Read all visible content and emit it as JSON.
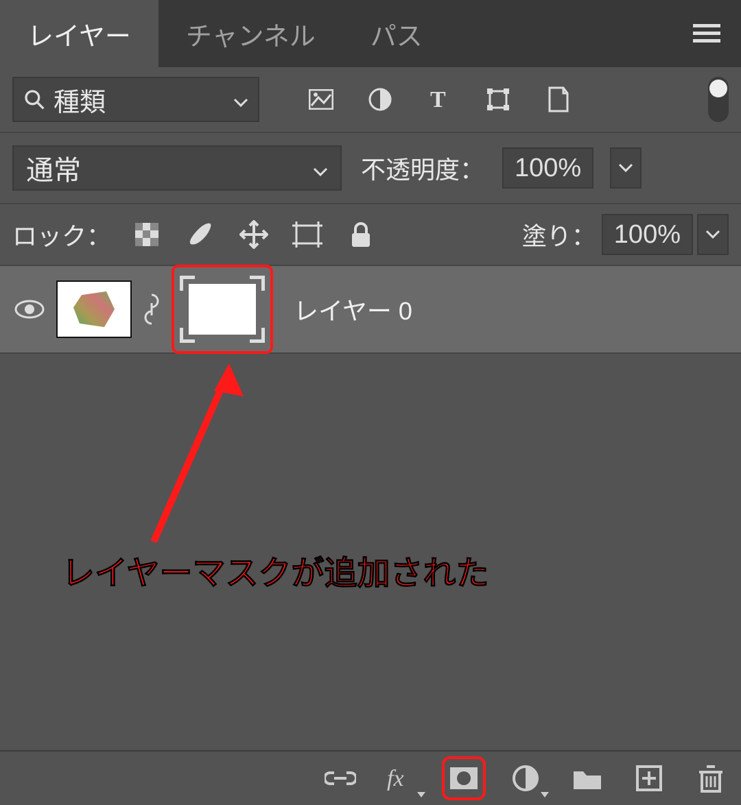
{
  "tabs": {
    "layers": "レイヤー",
    "channels": "チャンネル",
    "paths": "パス"
  },
  "filter": {
    "kind_label": "種類"
  },
  "blend": {
    "mode": "通常",
    "opacity_label": "不透明度：",
    "opacity_value": "100%"
  },
  "lock": {
    "label": "ロック：",
    "fill_label": "塗り：",
    "fill_value": "100%"
  },
  "layer0": {
    "name": "レイヤー 0"
  },
  "annotation": {
    "text": "レイヤーマスクが追加された"
  },
  "colors": {
    "highlight": "#ff1a1a"
  }
}
